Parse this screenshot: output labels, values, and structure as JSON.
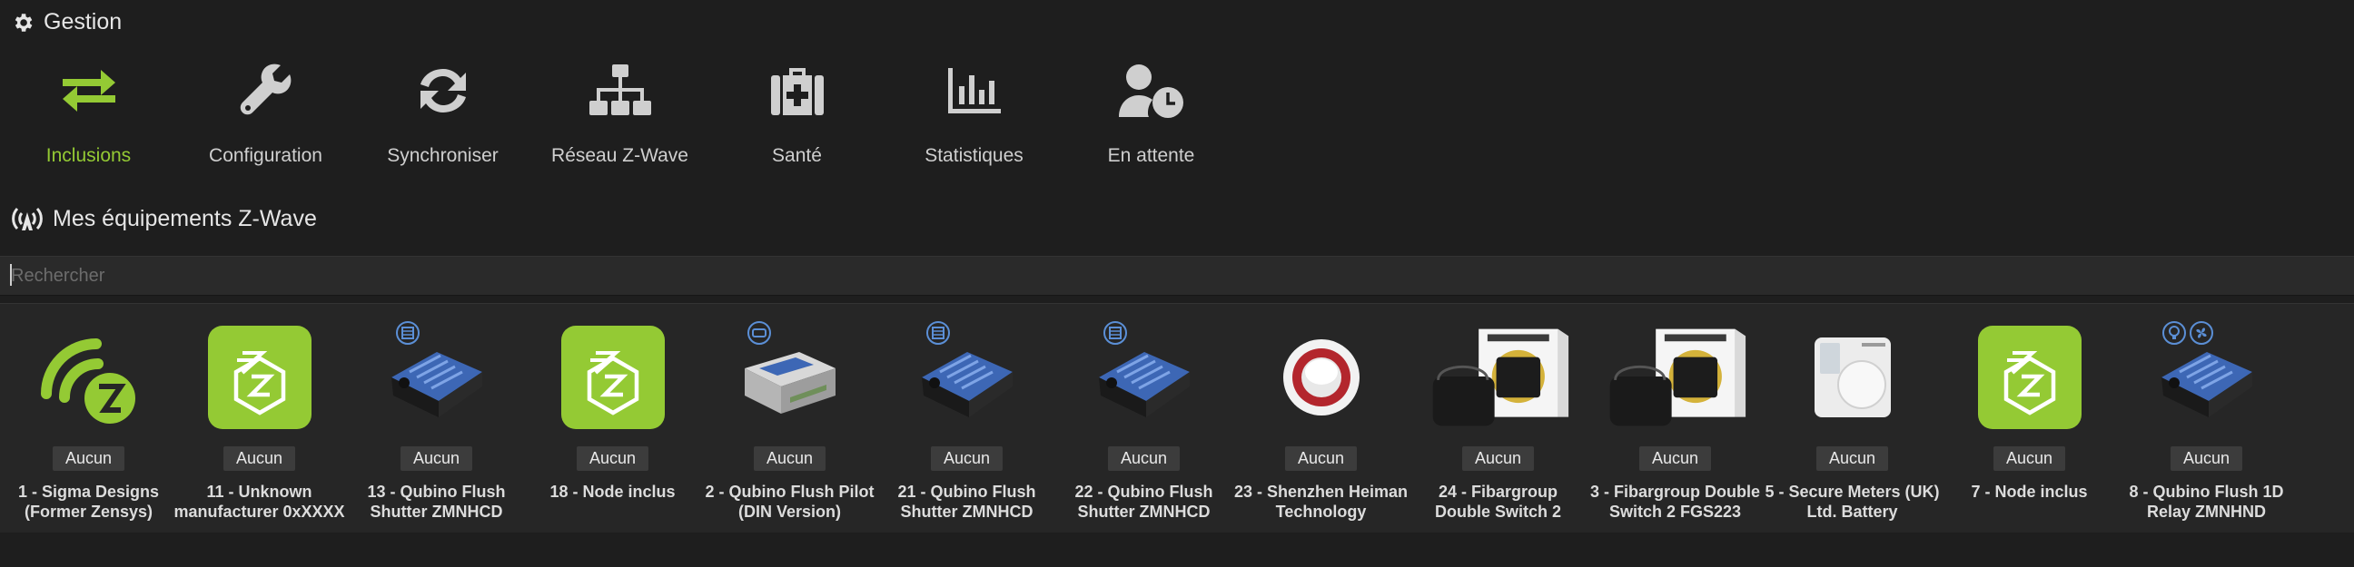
{
  "gestion": {
    "title": "Gestion"
  },
  "management": [
    {
      "label": "Inclusions",
      "icon": "arrows-exchange-icon",
      "active": true
    },
    {
      "label": "Configuration",
      "icon": "wrench-icon"
    },
    {
      "label": "Synchroniser",
      "icon": "sync-icon"
    },
    {
      "label": "Réseau Z-Wave",
      "icon": "network-icon"
    },
    {
      "label": "Santé",
      "icon": "medkit-icon"
    },
    {
      "label": "Statistiques",
      "icon": "bar-chart-icon"
    },
    {
      "label": "En attente",
      "icon": "user-clock-icon"
    }
  ],
  "equipments": {
    "title": "Mes équipements Z-Wave"
  },
  "search": {
    "placeholder": "Rechercher",
    "value": ""
  },
  "devices": [
    {
      "badge": "Aucun",
      "name": "1 - Sigma Designs (Former Zensys)",
      "image": "zwave-logo"
    },
    {
      "badge": "Aucun",
      "name": "11 - Unknown manufacturer 0xXXXX",
      "image": "zwave-tile"
    },
    {
      "badge": "Aucun",
      "name": "13 - Qubino Flush Shutter ZMNHCD",
      "image": "qubino-module"
    },
    {
      "badge": "Aucun",
      "name": "18 - Node inclus",
      "image": "zwave-tile"
    },
    {
      "badge": "Aucun",
      "name": "2 - Qubino Flush Pilot (DIN Version)",
      "image": "din-module"
    },
    {
      "badge": "Aucun",
      "name": "21 - Qubino Flush Shutter ZMNHCD",
      "image": "qubino-module"
    },
    {
      "badge": "Aucun",
      "name": "22 - Qubino Flush Shutter ZMNHCD",
      "image": "qubino-module"
    },
    {
      "badge": "Aucun",
      "name": "23 - Shenzhen Heiman Technology",
      "image": "siren"
    },
    {
      "badge": "Aucun",
      "name": "24 - Fibargroup Double Switch 2",
      "image": "fibaro-box"
    },
    {
      "badge": "Aucun",
      "name": "3 - Fibargroup Double Switch 2 FGS223",
      "image": "fibaro-box"
    },
    {
      "badge": "Aucun",
      "name": "5 - Secure Meters (UK) Ltd. Battery",
      "image": "thermostat"
    },
    {
      "badge": "Aucun",
      "name": "7 - Node inclus",
      "image": "zwave-tile"
    },
    {
      "badge": "Aucun",
      "name": "8 - Qubino Flush 1D Relay ZMNHND",
      "image": "qubino-module"
    }
  ],
  "colors": {
    "accent": "#94ca34",
    "background": "#1e1e1e",
    "panel": "#262626"
  }
}
